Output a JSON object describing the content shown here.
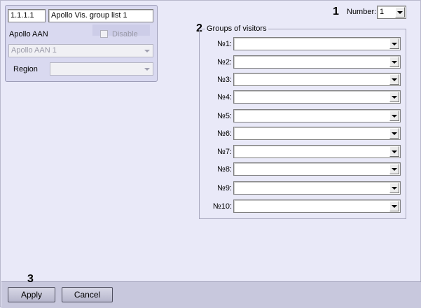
{
  "object": {
    "id_value": "1.1.1.1",
    "name_value": "Apollo Vis. group list 1",
    "parent_label": "Apollo AAN",
    "disable_label": "Disable",
    "parent_select_value": "Apollo AAN 1",
    "region_label": "Region",
    "region_value": ""
  },
  "callouts": {
    "one": "1",
    "two": "2",
    "three": "3"
  },
  "number": {
    "label": "Number:",
    "value": "1"
  },
  "groups": {
    "title": "Groups of visitors",
    "rows": [
      {
        "label": "№1:",
        "value": ""
      },
      {
        "label": "№2:",
        "value": ""
      },
      {
        "label": "№3:",
        "value": ""
      },
      {
        "label": "№4:",
        "value": ""
      },
      {
        "label": "№5:",
        "value": ""
      },
      {
        "label": "№6:",
        "value": ""
      },
      {
        "label": "№7:",
        "value": ""
      },
      {
        "label": "№8:",
        "value": ""
      },
      {
        "label": "№9:",
        "value": ""
      },
      {
        "label": "№10:",
        "value": ""
      }
    ]
  },
  "buttons": {
    "apply": "Apply",
    "cancel": "Cancel"
  }
}
